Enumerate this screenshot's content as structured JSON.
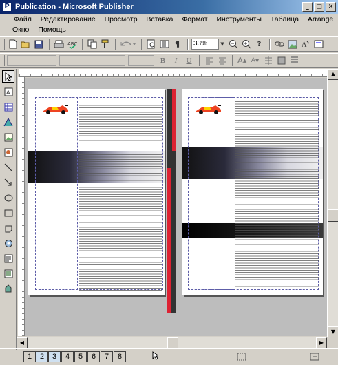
{
  "window": {
    "app_icon": "P",
    "title": "Publication - Microsoft Publisher",
    "minimize": "_",
    "maximize": "□",
    "close": "✕"
  },
  "menu": {
    "items": [
      "Файл",
      "Редактирование",
      "Просмотр",
      "Вставка",
      "Формат",
      "Инструменты",
      "Таблица",
      "Arrange",
      "Окно",
      "Помощь"
    ]
  },
  "toolbar": {
    "zoom_value": "33%",
    "icons": [
      "new-icon",
      "open-icon",
      "save-icon",
      "print-icon",
      "spell-check-icon",
      "copy-icon",
      "format-painter-icon",
      "undo-icon",
      "zoom-page-icon",
      "special-characters-icon",
      "zoom-out-icon",
      "zoom-in-icon",
      "help-icon"
    ]
  },
  "format_toolbar": {
    "bold": "B",
    "italic": "I",
    "underline": "U",
    "icons": [
      "align-left-icon",
      "align-center-icon",
      "font-size-up-icon",
      "font-size-down-icon",
      "line-spacing-icon",
      "fill-color-icon",
      "line-color-icon"
    ]
  },
  "left_tools": [
    "pointer-icon",
    "text-frame-icon",
    "table-frame-icon",
    "wordart-icon",
    "picture-frame-icon",
    "clipart-icon",
    "line-icon",
    "arrow-icon",
    "oval-icon",
    "rectangle-icon",
    "custom-shape-icon",
    "hot-spot-icon",
    "form-control-icon",
    "html-fragment-icon",
    "design-gallery-icon"
  ],
  "status": {
    "pages": [
      "1",
      "2",
      "3",
      "4",
      "5",
      "6",
      "7",
      "8"
    ],
    "active_pages": [
      "2",
      "3"
    ]
  },
  "colors": {
    "title_bar": "#0a246a",
    "workspace": "#bdbdbd",
    "spine_red": "#dd2233"
  }
}
